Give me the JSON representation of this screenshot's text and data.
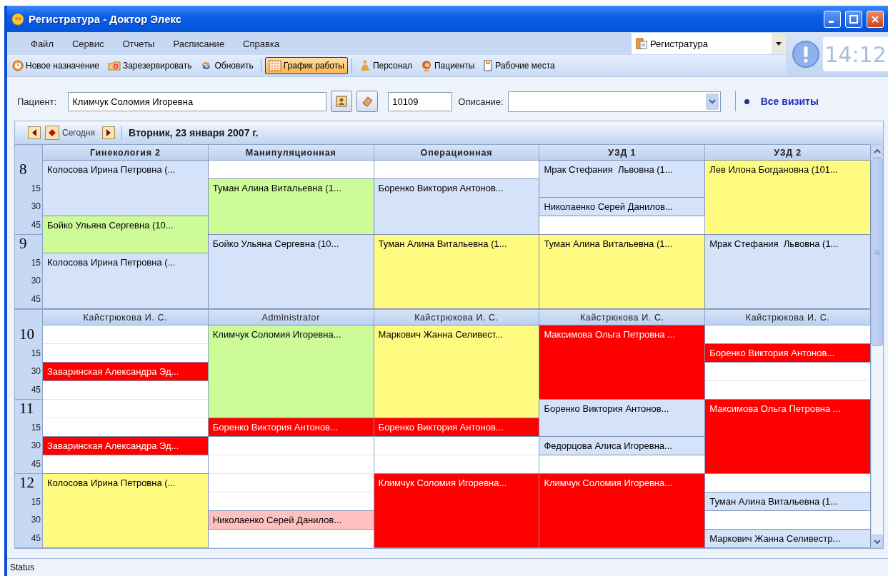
{
  "window": {
    "title": "Регистратура - Доктор Элекс"
  },
  "menu": [
    "Файл",
    "Сервис",
    "Отчеты",
    "Расписание",
    "Справка"
  ],
  "toolbar": [
    {
      "label": "Новое назначение",
      "selected": false
    },
    {
      "label": "Зарезервировать",
      "selected": false
    },
    {
      "label": "Обновить",
      "selected": false
    },
    {
      "label": "График работы",
      "selected": true
    },
    {
      "label": "Персонал",
      "selected": false
    },
    {
      "label": "Пациенты",
      "selected": false
    },
    {
      "label": "Рабочие места",
      "selected": false
    }
  ],
  "workplace": {
    "value": "Регистратура"
  },
  "clock": "14:12",
  "patient": {
    "label": "Пациент:",
    "value": "Климчук Соломия Игоревна",
    "id": "10109",
    "description_label": "Описание:",
    "all_visits": "Все визиты"
  },
  "navigation": {
    "today": "Сегодня",
    "date": "Вторник, 23 января 2007 г."
  },
  "sections": [
    {
      "kind": "rooms",
      "headers": [
        "Гинекология 2",
        "Манипуляционная",
        "Операционная",
        "УЗД 1",
        "УЗД 2"
      ],
      "hours": [
        {
          "hour": "8",
          "minutes": [
            "15",
            "30",
            "45"
          ]
        },
        {
          "hour": "9",
          "minutes": [
            "15",
            "30",
            "45"
          ]
        }
      ],
      "columns": [
        [
          {
            "kind": "visit",
            "text": "Колосова Ирина Петровна (...",
            "color": "#d4e2fa"
          },
          {
            "kind": "cont"
          },
          {
            "kind": "cont"
          },
          {
            "kind": "visit",
            "text": "Бойко Ульяна Сергевна (10...",
            "color": "#ccfb98"
          },
          {
            "kind": "cont"
          },
          {
            "kind": "visit",
            "text": "Колосова Ирина Петровна (...",
            "color": "#d4e2fa"
          },
          {
            "kind": "cont"
          },
          {
            "kind": "cont"
          }
        ],
        [
          {
            "kind": "free"
          },
          {
            "kind": "visit",
            "text": "Туман Алина Витальевна (1...",
            "color": "#ccfb98"
          },
          {
            "kind": "cont"
          },
          {
            "kind": "cont"
          },
          {
            "kind": "visit",
            "text": "Бойко Ульяна Сергевна (10...",
            "color": "#d4e2fa"
          },
          {
            "kind": "cont"
          },
          {
            "kind": "cont"
          },
          {
            "kind": "cont"
          }
        ],
        [
          {
            "kind": "free"
          },
          {
            "kind": "visit",
            "text": "Боренко Виктория Антонов...",
            "color": "#d4e2fa"
          },
          {
            "kind": "cont"
          },
          {
            "kind": "cont"
          },
          {
            "kind": "visit",
            "text": "Туман Алина Витальевна (1...",
            "color": "#fffa80"
          },
          {
            "kind": "cont"
          },
          {
            "kind": "cont"
          },
          {
            "kind": "cont"
          }
        ],
        [
          {
            "kind": "visit",
            "text": "Мрак Стефания  Львовна (1...",
            "color": "#d4e2fa"
          },
          {
            "kind": "cont"
          },
          {
            "kind": "visit",
            "text": "Николаенко Серей Данилов...",
            "color": "#d4e2fa"
          },
          {
            "kind": "free"
          },
          {
            "kind": "visit",
            "text": "Туман Алина Витальевна (1...",
            "color": "#fffa80"
          },
          {
            "kind": "cont"
          },
          {
            "kind": "cont"
          },
          {
            "kind": "cont"
          }
        ],
        [
          {
            "kind": "visit",
            "text": "Лев Илона Богдановна (101...",
            "color": "#fffa80"
          },
          {
            "kind": "cont"
          },
          {
            "kind": "cont"
          },
          {
            "kind": "cont"
          },
          {
            "kind": "visit",
            "text": "Мрак Стефания  Львовна (1...",
            "color": "#d4e2fa"
          },
          {
            "kind": "cont"
          },
          {
            "kind": "cont"
          },
          {
            "kind": "cont"
          }
        ]
      ]
    },
    {
      "kind": "staff",
      "headers": [
        "Кайстрюкова И. С.",
        "Administrator",
        "Кайстрюкова И. С.",
        "Кайстрюкова И. С.",
        "Кайстрюкова И. С."
      ],
      "hours": [
        {
          "hour": "10",
          "minutes": [
            "15",
            "30",
            "45"
          ]
        },
        {
          "hour": "11",
          "minutes": [
            "15",
            "30",
            "45"
          ]
        },
        {
          "hour": "12",
          "minutes": [
            "15",
            "30",
            "45"
          ]
        }
      ],
      "columns": [
        [
          {
            "kind": "free"
          },
          {
            "kind": "free"
          },
          {
            "kind": "visit",
            "text": "Заваринская Александра Эд...",
            "color": "#ff0000"
          },
          {
            "kind": "free"
          },
          {
            "kind": "free"
          },
          {
            "kind": "free"
          },
          {
            "kind": "visit",
            "text": "Заваринская Александра Эд...",
            "color": "#ff0000"
          },
          {
            "kind": "free"
          },
          {
            "kind": "visit",
            "text": "Колосова Ирина Петровна (...",
            "color": "#fffa80"
          },
          {
            "kind": "cont"
          },
          {
            "kind": "cont"
          },
          {
            "kind": "cont"
          }
        ],
        [
          {
            "kind": "visit",
            "text": "Климчук Соломия Игоревна...",
            "color": "#ccfb98"
          },
          {
            "kind": "cont"
          },
          {
            "kind": "cont"
          },
          {
            "kind": "cont"
          },
          {
            "kind": "cont"
          },
          {
            "kind": "visit",
            "text": "Боренко Виктория Антонов...",
            "color": "#ff0000"
          },
          {
            "kind": "free"
          },
          {
            "kind": "free"
          },
          {
            "kind": "free"
          },
          {
            "kind": "free"
          },
          {
            "kind": "visit",
            "text": "Николаенко Серей Данилов...",
            "color": "#ffc0c0"
          },
          {
            "kind": "free"
          }
        ],
        [
          {
            "kind": "visit",
            "text": "Маркович Жанна Селивест...",
            "color": "#fffa80"
          },
          {
            "kind": "cont"
          },
          {
            "kind": "cont"
          },
          {
            "kind": "cont"
          },
          {
            "kind": "cont"
          },
          {
            "kind": "visit",
            "text": "Боренко Виктория Антонов...",
            "color": "#ff0000"
          },
          {
            "kind": "free"
          },
          {
            "kind": "free"
          },
          {
            "kind": "visit",
            "text": "Климчук Соломия Игоревна...",
            "color": "#ff0000"
          },
          {
            "kind": "cont"
          },
          {
            "kind": "cont"
          },
          {
            "kind": "cont"
          }
        ],
        [
          {
            "kind": "visit",
            "text": "Максимова Ольга Петровна ...",
            "color": "#ff0000"
          },
          {
            "kind": "cont"
          },
          {
            "kind": "cont"
          },
          {
            "kind": "cont"
          },
          {
            "kind": "visit",
            "text": "Боренко Виктория Антонов...",
            "color": "#d4e2fa"
          },
          {
            "kind": "cont"
          },
          {
            "kind": "visit",
            "text": "Федорцова Алиса Игоревна...",
            "color": "#d4e2fa"
          },
          {
            "kind": "free"
          },
          {
            "kind": "visit",
            "text": "Климчук Соломия Игоревна...",
            "color": "#ff0000"
          },
          {
            "kind": "cont"
          },
          {
            "kind": "cont"
          },
          {
            "kind": "cont"
          }
        ],
        [
          {
            "kind": "free"
          },
          {
            "kind": "visit",
            "text": "Боренко Виктория Антонов...",
            "color": "#ff0000"
          },
          {
            "kind": "free"
          },
          {
            "kind": "free"
          },
          {
            "kind": "visit",
            "text": "Максимова Ольга Петровна ...",
            "color": "#ff0000"
          },
          {
            "kind": "cont"
          },
          {
            "kind": "cont"
          },
          {
            "kind": "cont"
          },
          {
            "kind": "free"
          },
          {
            "kind": "visit",
            "text": "Туман Алина Витальевна (1...",
            "color": "#d4e2fa"
          },
          {
            "kind": "free"
          },
          {
            "kind": "visit",
            "text": "Маркович Жанна Селивестр...",
            "color": "#d4e2fa"
          }
        ]
      ]
    }
  ],
  "status_bar": "Status"
}
